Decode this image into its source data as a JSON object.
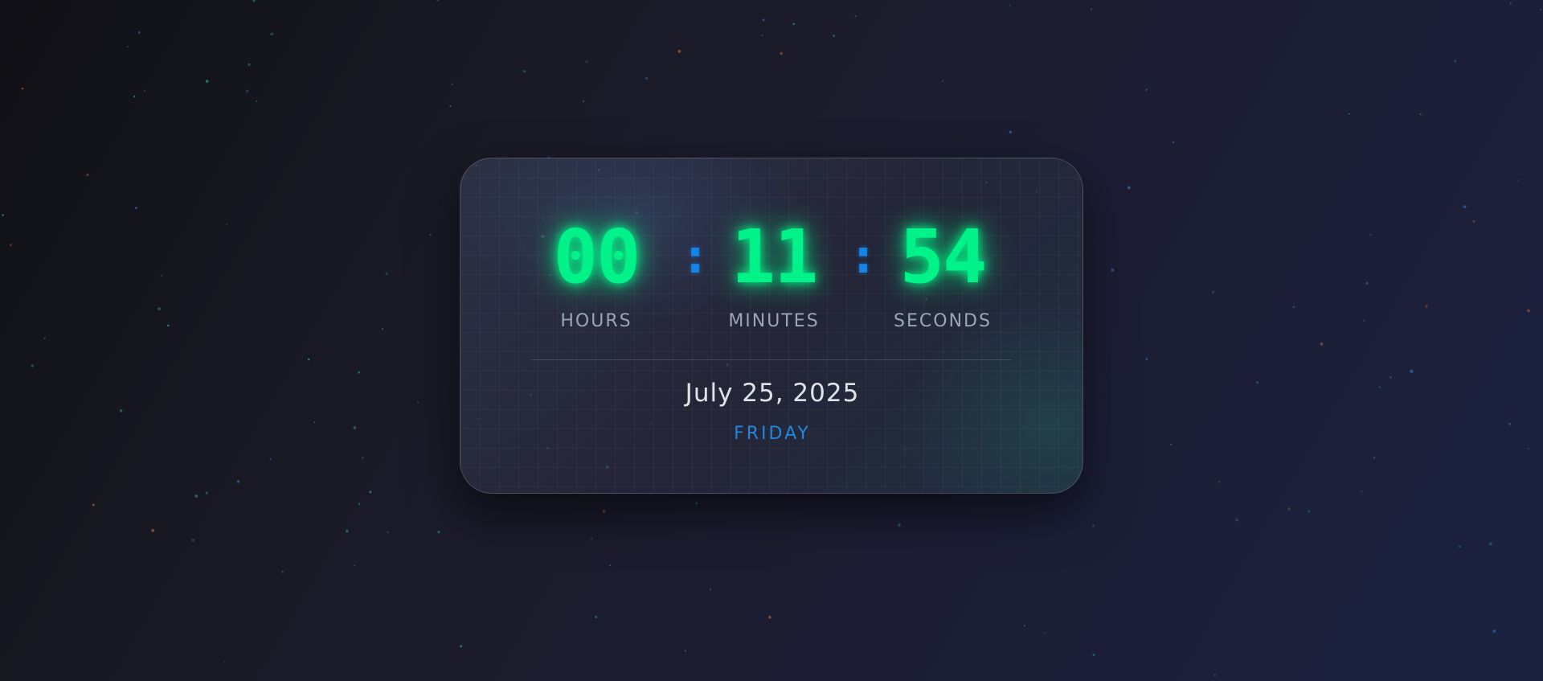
{
  "clock": {
    "hours": "00",
    "minutes": "11",
    "seconds": "54",
    "separator": ":",
    "labels": {
      "hours": "HOURS",
      "minutes": "MINUTES",
      "seconds": "SECONDS"
    }
  },
  "date": {
    "full": "July 25, 2025",
    "weekday": "FRIDAY"
  },
  "colors": {
    "digit": "#00f288",
    "separator": "#1584e6",
    "weekday": "#1f86e0",
    "label": "#9aa7b3",
    "date": "#dfe3ea"
  }
}
